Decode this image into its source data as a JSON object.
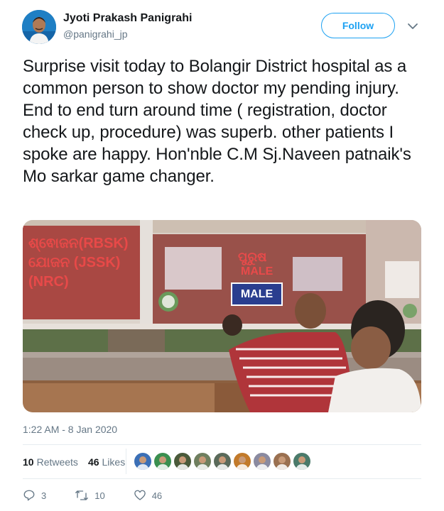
{
  "author": {
    "name": "Jyoti Prakash Panigrahi",
    "handle": "@panigrahi_jp"
  },
  "follow_label": "Follow",
  "tweet_text": "Surprise visit today to Bolangir District hospital as a common person to show doctor my pending injury. End to end turn around time ( registration, doctor check up, procedure) was superb. other patients I spoke are happy. Hon'nble C.M Sj.Naveen patnaik's Mo sarkar game changer.",
  "photo": {
    "sign_left_lines": [
      "ଶ୍ଵୋଜନ(RBSK)",
      "ଯୋଜନ (JSSK)",
      "(NRC)"
    ],
    "sign_center_script": "ପୁରୁଷ",
    "sign_center_red": "MALE",
    "male_sign": "MALE"
  },
  "timestamp": "1:22 AM - 8 Jan 2020",
  "stats": {
    "retweets_count": "10",
    "retweets_label": "Retweets",
    "likes_count": "46",
    "likes_label": "Likes"
  },
  "likers": [
    {
      "icon": "liker-avatar",
      "color": "#3b6fb6"
    },
    {
      "icon": "liker-avatar",
      "color": "#3a8f4f"
    },
    {
      "icon": "liker-avatar",
      "color": "#4a5a3a"
    },
    {
      "icon": "liker-avatar",
      "color": "#6f7f5f"
    },
    {
      "icon": "liker-avatar",
      "color": "#5a6a5a"
    },
    {
      "icon": "liker-avatar",
      "color": "#c27a2a"
    },
    {
      "icon": "liker-avatar",
      "color": "#8a8aa0"
    },
    {
      "icon": "liker-avatar",
      "color": "#9a7050"
    },
    {
      "icon": "liker-avatar",
      "color": "#4a7a6a"
    }
  ],
  "actions": {
    "reply_count": "3",
    "retweet_count": "10",
    "like_count": "46"
  },
  "colors": {
    "accent": "#1da1f2",
    "secondary_text": "#657786",
    "divider": "#e6ecf0"
  }
}
